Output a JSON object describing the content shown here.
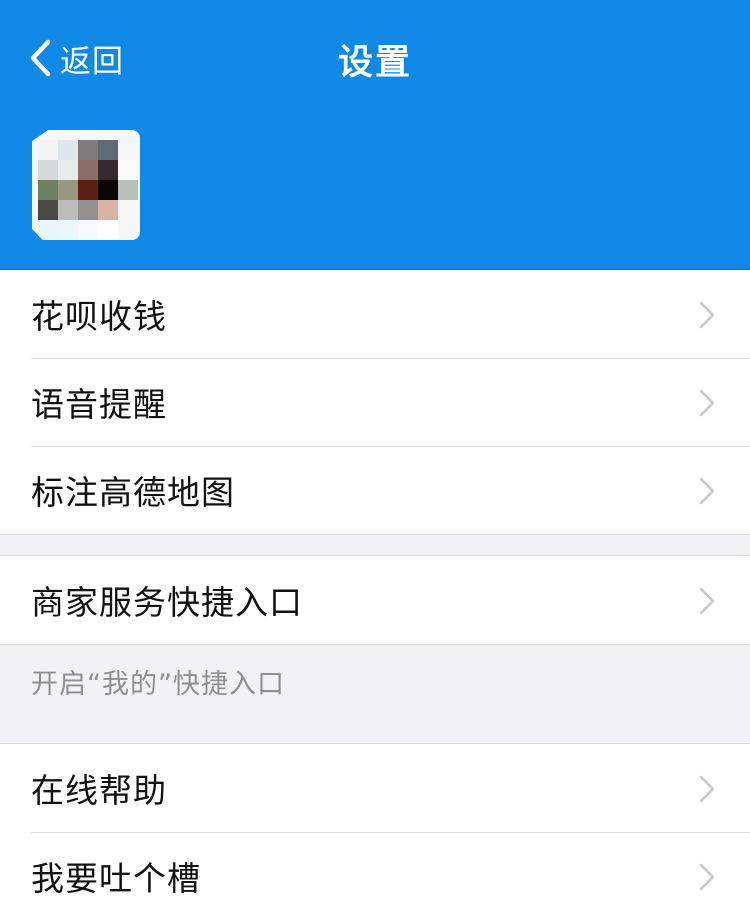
{
  "header": {
    "back_label": "返回",
    "title": "设置",
    "background_color": "#1089e6"
  },
  "avatar": {
    "pixels": [
      "#f2f4f6",
      "#dfe6ec",
      "#7d7b7d",
      "#5f6a74",
      "#f6f7f8",
      "#d5d8d9",
      "#e8eaec",
      "#8b6e68",
      "#352b2c",
      "#fafafa",
      "#6e8160",
      "#99977f",
      "#5a1f14",
      "#0a0605",
      "#b7bfb6",
      "#4b4848",
      "#bcbcbc",
      "#949090",
      "#d8b5a2",
      "#f7f7f7",
      "#e8f6fb",
      "#eaf8fc",
      "#f5fbfd",
      "#ffffff",
      "#f5f7f9"
    ]
  },
  "groups": [
    {
      "items": [
        {
          "label": "花呗收钱"
        },
        {
          "label": "语音提醒"
        },
        {
          "label": "标注高德地图"
        }
      ]
    },
    {
      "items": [
        {
          "label": "商家服务快捷入口"
        }
      ]
    },
    {
      "items": [
        {
          "label": "在线帮助"
        },
        {
          "label": "我要吐个槽"
        }
      ]
    }
  ],
  "shortcut_note": "开启“我的”快捷入口",
  "icons": {
    "back": "chevron-left-icon",
    "row": "chevron-right-icon"
  }
}
